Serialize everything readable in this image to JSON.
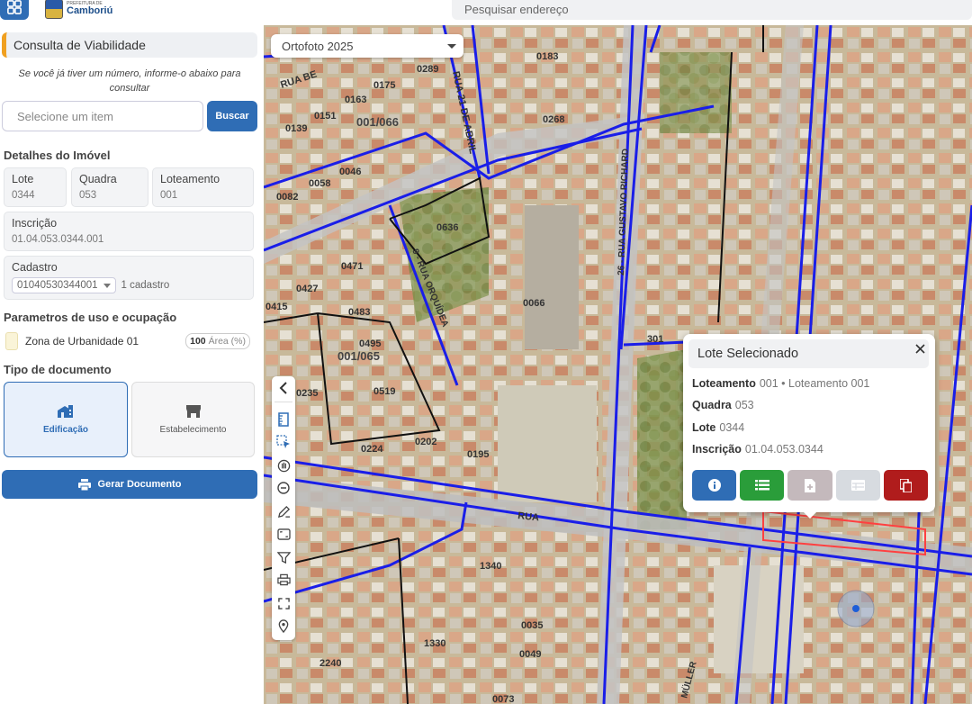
{
  "topbar": {
    "logo_small": "PREFEITURA DE",
    "logo_name": "Camboriú",
    "search_placeholder": "Pesquisar endereço"
  },
  "panel": {
    "title": "Consulta de Viabilidade",
    "hint": "Se você já tiver um número, informe-o abaixo para consultar",
    "select_placeholder": "Selecione um item",
    "search_button": "Buscar",
    "details_title": "Detalhes do Imóvel",
    "lote": {
      "label": "Lote",
      "value": "0344"
    },
    "quadra": {
      "label": "Quadra",
      "value": "053"
    },
    "loteamento": {
      "label": "Loteamento",
      "value": "001"
    },
    "inscricao": {
      "label": "Inscrição",
      "value": "01.04.053.0344.001"
    },
    "cadastro": {
      "label": "Cadastro",
      "selected": "01040530344001",
      "count": "1 cadastro"
    },
    "params_title": "Parametros de uso e ocupação",
    "zona": {
      "label": "Zona de Urbanidade 01",
      "area_value": "100",
      "area_unit": "Área (%)"
    },
    "doc_type_title": "Tipo de documento",
    "doc_types": [
      {
        "label": "Edificação",
        "icon": "building-icon",
        "active": true
      },
      {
        "label": "Estabelecimento",
        "icon": "store-icon",
        "active": false
      }
    ],
    "generate_button": "Gerar Documento"
  },
  "map": {
    "layer_selected": "Ortofoto 2025",
    "labels": [
      "RUA BE",
      "0289",
      "RUA 21 DE ABRIL",
      "0183",
      "0175",
      "0163",
      "001/066",
      "0139",
      "0151",
      "0268",
      "0046",
      "0058",
      "0082",
      "0636",
      "9 - RUA ORQUÍDEA",
      "26 - RUA GUSTAVO RICHARD",
      "0471",
      "0427",
      "0483",
      "0415",
      "0066",
      "0495",
      "001/065",
      "0519",
      "0235",
      "0224",
      "0202",
      "0195",
      "301",
      "RUA",
      "1340",
      "0035",
      "0049",
      "1330",
      "2240",
      "0073",
      "MÜLLER"
    ],
    "toolbar": [
      "collapse-icon",
      "ruler-icon",
      "select-area-icon",
      "pan-icon",
      "zoom-out-icon",
      "edit-icon",
      "frame-icon",
      "filter-icon",
      "print-icon",
      "fullscreen-icon",
      "location-icon"
    ]
  },
  "popup": {
    "title": "Lote Selecionado",
    "rows": [
      {
        "key": "Loteamento",
        "value": "001 • Loteamento 001"
      },
      {
        "key": "Quadra",
        "value": "053"
      },
      {
        "key": "Lote",
        "value": "0344"
      },
      {
        "key": "Inscrição",
        "value": "01.04.053.0344"
      }
    ],
    "actions": [
      {
        "icon": "info-icon",
        "color": "#2f6db5"
      },
      {
        "icon": "list-icon",
        "color": "#2a9d3a"
      },
      {
        "icon": "document-add-icon",
        "color": "#c4b9bc"
      },
      {
        "icon": "table-icon",
        "color": "#d7dbe0"
      },
      {
        "icon": "copy-icon",
        "color": "#b01c1c"
      }
    ]
  },
  "colors": {
    "primary": "#2f6db5",
    "accent": "#f0a020",
    "road_line": "#1a1ee8",
    "success": "#2a9d3a",
    "danger": "#b01c1c"
  }
}
